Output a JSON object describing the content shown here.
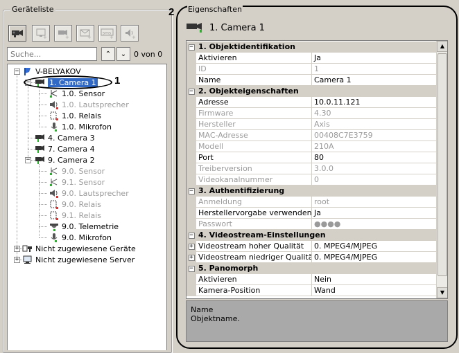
{
  "left_panel": {
    "legend": "Geräteliste",
    "toolbar_icons": [
      "camera-add-icon",
      "monitor-add-icon",
      "camera-small-add-icon",
      "mail-add-icon",
      "sms-add-icon",
      "speaker-add-icon"
    ],
    "search_placeholder": "Suche...",
    "up_glyph": "⌃",
    "down_glyph": "⌄",
    "count": "0 von 0",
    "tree": {
      "root": "V-BELYAKOV",
      "cam1": "1. Camera 1",
      "cam1_sensor": "1.0. Sensor",
      "cam1_speaker": "1.0. Lautsprecher",
      "cam1_relay": "1.0. Relais",
      "cam1_mic": "1.0. Mikrofon",
      "cam4": "4. Camera 3",
      "cam7": "7. Camera 4",
      "cam9": "9. Camera 2",
      "cam9_sensor0": "9.0. Sensor",
      "cam9_sensor1": "9.1. Sensor",
      "cam9_speaker": "9.0. Lautsprecher",
      "cam9_relay0": "9.0. Relais",
      "cam9_relay1": "9.1. Relais",
      "cam9_telemetry": "9.0. Telemetrie",
      "cam9_mic": "9.0. Mikrofon",
      "unassigned_devices": "Nicht zugewiesene Geräte",
      "unassigned_servers": "Nicht zugewiesene Server"
    },
    "callout": "1"
  },
  "right_panel": {
    "legend": "Eigenschaften",
    "callout": "2",
    "title": "1. Camera 1",
    "categories": {
      "c1": "1. Objektidentifikation",
      "c2": "2. Objekteigenschaften",
      "c3": "3. Authentifizierung",
      "c4": "4. Videostream-Einstellungen",
      "c5": "5. Panomorph"
    },
    "props": [
      {
        "name": "Aktivieren",
        "value": "Ja"
      },
      {
        "name": "ID",
        "value": "1"
      },
      {
        "name": "Name",
        "value": "Camera 1"
      },
      {
        "name": "Adresse",
        "value": "10.0.11.121"
      },
      {
        "name": "Firmware",
        "value": "4.30"
      },
      {
        "name": "Hersteller",
        "value": "Axis"
      },
      {
        "name": "MAC-Adresse",
        "value": "00408C7E3759"
      },
      {
        "name": "Modell",
        "value": "210A"
      },
      {
        "name": "Port",
        "value": "80"
      },
      {
        "name": "Treiberversion",
        "value": "3.0.0"
      },
      {
        "name": "Videokanalnummer",
        "value": "0"
      },
      {
        "name": "Anmeldung",
        "value": "root"
      },
      {
        "name": "Herstellervorgabe verwenden",
        "value": "Ja"
      },
      {
        "name": "Passwort",
        "value": "●●●●"
      },
      {
        "name": "Videostream hoher Qualität",
        "value": "0. MPEG4/MJPEG"
      },
      {
        "name": "Videostream niedriger Qualität",
        "value": "0. MPEG4/MJPEG"
      },
      {
        "name": "Aktivieren",
        "value": "Nein"
      },
      {
        "name": "Kamera-Position",
        "value": "Wand"
      }
    ],
    "description": {
      "name": "Name",
      "text": "Objektname."
    }
  }
}
